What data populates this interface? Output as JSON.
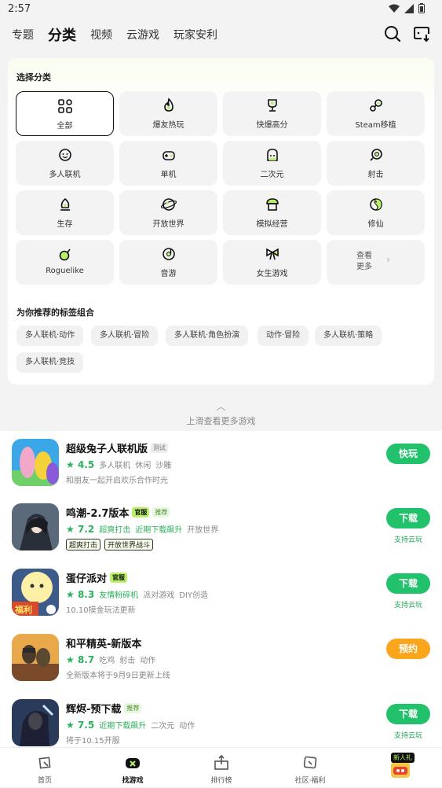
{
  "status": {
    "time": "2:57"
  },
  "nav": {
    "tabs": [
      "专题",
      "分类",
      "视频",
      "云游戏",
      "玩家安利"
    ],
    "active": "分类"
  },
  "categories": {
    "header": "选择分类",
    "items": [
      {
        "label": "全部",
        "icon": "grid-icon",
        "selected": true
      },
      {
        "label": "爆友热玩",
        "icon": "fire-icon"
      },
      {
        "label": "快爆高分",
        "icon": "trophy-icon"
      },
      {
        "label": "Steam移植",
        "icon": "steam-icon"
      },
      {
        "label": "多人联机",
        "icon": "multiplayer-icon"
      },
      {
        "label": "单机",
        "icon": "gamepad-icon"
      },
      {
        "label": "二次元",
        "icon": "anime-icon"
      },
      {
        "label": "射击",
        "icon": "target-icon"
      },
      {
        "label": "生存",
        "icon": "survival-icon"
      },
      {
        "label": "开放世界",
        "icon": "globe-icon"
      },
      {
        "label": "模拟经营",
        "icon": "shop-icon"
      },
      {
        "label": "修仙",
        "icon": "yinyang-icon"
      },
      {
        "label": "Roguelike",
        "icon": "bomb-icon"
      },
      {
        "label": "音游",
        "icon": "music-icon"
      },
      {
        "label": "女生游戏",
        "icon": "bow-icon"
      }
    ],
    "more_label_1": "查看",
    "more_label_2": "更多",
    "rec_header": "为你推荐的标签组合",
    "chips": [
      "多人联机·动作",
      "多人联机·冒险",
      "多人联机·角色扮演",
      "动作·冒险",
      "多人联机·策略",
      "多人联机·竞技"
    ]
  },
  "swipe_hint": "上滑查看更多游戏",
  "games": [
    {
      "title": "超级兔子人联机版",
      "badges": [
        {
          "text": "测试",
          "type": "test"
        }
      ],
      "score": "4.5",
      "tags": [
        "多人联机",
        "休闲",
        "沙雕"
      ],
      "highlight_tags": [],
      "desc": "和朋友一起开启欢乐合作时光",
      "outline_tags": [],
      "button": "快玩",
      "button_color": "green",
      "cloud": ""
    },
    {
      "title": "鸣潮-2.7版本",
      "badges": [
        {
          "text": "官服",
          "type": "off"
        },
        {
          "text": "推荐",
          "type": "rec"
        }
      ],
      "score": "7.2",
      "highlight_tags": [
        "超爽打击",
        "近期下载飙升"
      ],
      "tags": [
        "开放世界"
      ],
      "desc": "",
      "outline_tags": [
        "超爽打击",
        "开放世界战斗"
      ],
      "button": "下载",
      "button_color": "green",
      "cloud": "支持云玩"
    },
    {
      "title": "蛋仔派对",
      "badges": [
        {
          "text": "官服",
          "type": "off"
        }
      ],
      "score": "8.3",
      "highlight_tags": [
        "友情粉碎机"
      ],
      "tags": [
        "派对游戏",
        "DIY创造"
      ],
      "desc": "10.10摸金玩法更新",
      "outline_tags": [],
      "button": "下载",
      "button_color": "green",
      "cloud": "支持云玩"
    },
    {
      "title": "和平精英-新版本",
      "badges": [],
      "score": "8.7",
      "highlight_tags": [],
      "tags": [
        "吃鸡",
        "射击",
        "动作"
      ],
      "desc": "全新版本将于9月9日更新上线",
      "outline_tags": [],
      "button": "预约",
      "button_color": "orange",
      "cloud": ""
    },
    {
      "title": "辉烬-预下载",
      "badges": [
        {
          "text": "推荐",
          "type": "rec"
        }
      ],
      "score": "7.5",
      "highlight_tags": [
        "近期下载飙升"
      ],
      "tags": [
        "二次元",
        "动作"
      ],
      "desc": "将于10.15开服",
      "outline_tags": [],
      "button": "下载",
      "button_color": "green",
      "cloud": "支持云玩"
    }
  ],
  "thumb_text": {
    "egg": "福利"
  },
  "bottom_nav": [
    {
      "label": "首页",
      "icon": "home-icon"
    },
    {
      "label": "找游戏",
      "icon": "gamepad-icon",
      "active": true
    },
    {
      "label": "排行榜",
      "icon": "ranking-icon"
    },
    {
      "label": "社区·福利",
      "icon": "community-icon"
    },
    {
      "label": "",
      "icon": "gift-icon",
      "badge": "新人礼"
    }
  ],
  "colors": {
    "accent": "#b8f06a",
    "download": "#21c26b",
    "reserve": "#f9a61c",
    "score": "#2bb15b"
  }
}
